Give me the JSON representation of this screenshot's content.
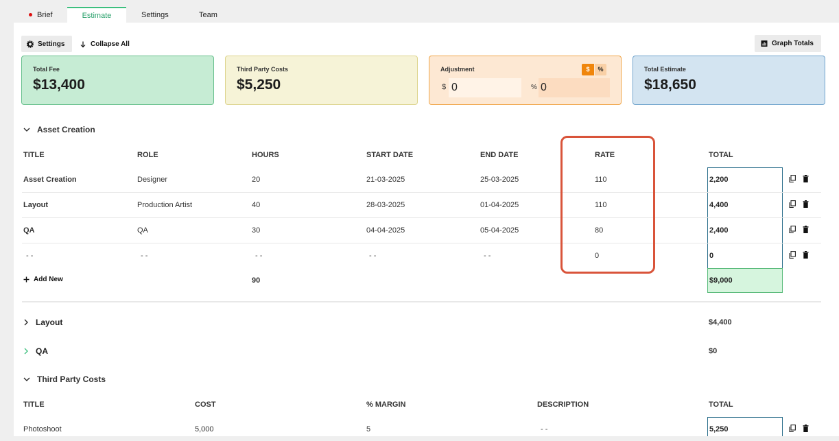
{
  "tabs": [
    {
      "label": "Brief",
      "active": false,
      "dot": true
    },
    {
      "label": "Estimate",
      "active": true
    },
    {
      "label": "Settings",
      "active": false
    },
    {
      "label": "Team",
      "active": false
    }
  ],
  "toolbar": {
    "settings_label": "Settings",
    "collapse_label": "Collapse All",
    "graph_label": "Graph Totals"
  },
  "summary": {
    "total_fee": {
      "label": "Total Fee",
      "value": "$13,400"
    },
    "third_party": {
      "label": "Third Party Costs",
      "value": "$5,250"
    },
    "adjustment": {
      "label": "Adjustment",
      "toggle_dollar": "$",
      "toggle_percent": "%",
      "dollar_prefix": "$",
      "dollar_value": "0",
      "percent_prefix": "%",
      "percent_value": "0"
    },
    "total_estimate": {
      "label": "Total Estimate",
      "value": "$18,650"
    }
  },
  "asset_section": {
    "title": "Asset Creation",
    "headers": {
      "title": "TITLE",
      "role": "ROLE",
      "hours": "HOURS",
      "start": "START DATE",
      "end": "END DATE",
      "rate": "RATE",
      "total": "TOTAL"
    },
    "rows": [
      {
        "title": "Asset Creation",
        "role": "Designer",
        "hours": "20",
        "start": "21-03-2025",
        "end": "25-03-2025",
        "rate": "110",
        "total": "2,200"
      },
      {
        "title": "Layout",
        "role": "Production Artist",
        "hours": "40",
        "start": "28-03-2025",
        "end": "01-04-2025",
        "rate": "110",
        "total": "4,400"
      },
      {
        "title": "QA",
        "role": "QA",
        "hours": "30",
        "start": "04-04-2025",
        "end": "05-04-2025",
        "rate": "80",
        "total": "2,400"
      },
      {
        "title": "- -",
        "role": "- -",
        "hours": "- -",
        "start": "- -",
        "end": "- -",
        "rate": "0",
        "total": "0"
      }
    ],
    "add_new": "Add New",
    "hours_total": "90",
    "grand_total": "$9,000"
  },
  "collapsed_sections": [
    {
      "title": "Layout",
      "total": "$4,400"
    },
    {
      "title": "QA",
      "total": "$0"
    }
  ],
  "third_party_section": {
    "title": "Third Party Costs",
    "headers": {
      "title": "TITLE",
      "cost": "COST",
      "margin": "% MARGIN",
      "description": "DESCRIPTION",
      "total": "TOTAL"
    },
    "rows": [
      {
        "title": "Photoshoot",
        "cost": "5,000",
        "margin": "5",
        "description": "- -",
        "total": "5,250"
      }
    ]
  },
  "colors": {
    "accent_green": "#3cbf7e",
    "highlight_red": "#d9543a",
    "total_border": "#2c6f8c"
  }
}
